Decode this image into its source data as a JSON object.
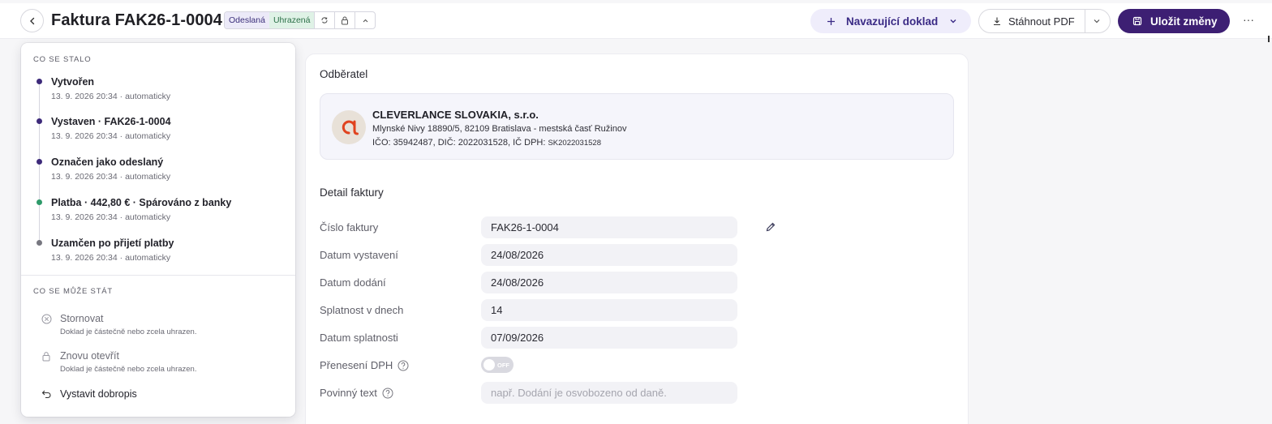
{
  "header": {
    "title": "Faktura FAK26-1-0004",
    "badges": {
      "sent": "Odeslaná",
      "paid": "Uhrazená"
    },
    "follow_label": "Navazující doklad",
    "pdf_label": "Stáhnout PDF",
    "save_label": "Uložit změny",
    "more_label": "···"
  },
  "history": {
    "title": "CO SE STALO",
    "items": [
      {
        "title": "Vytvořen",
        "sub": "13. 9. 2026 20:34 · automaticky",
        "color": "#3d2a7a"
      },
      {
        "title": "Vystaven · FAK26-1-0004",
        "sub": "13. 9. 2026 20:34 · automaticky",
        "color": "#3d2a7a"
      },
      {
        "title": "Označen jako odeslaný",
        "sub": "13. 9. 2026 20:34 · automaticky",
        "color": "#3d2a7a"
      },
      {
        "title": "Platba · 442,80 € · Spárováno z banky",
        "sub": "13. 9. 2026 20:34 · automaticky",
        "color": "#2e9a6a"
      },
      {
        "title": "Uzamčen po přijetí platby",
        "sub": "13. 9. 2026 20:34 · automaticky",
        "color": "#777780"
      }
    ]
  },
  "actions": {
    "title": "CO SE MŮŽE STÁT",
    "items": [
      {
        "title": "Stornovat",
        "sub": "Doklad je částečně nebo zcela uhrazen.",
        "icon": "cancel-circle-icon"
      },
      {
        "title": "Znovu otevřít",
        "sub": "Doklad je částečně nebo zcela uhrazen.",
        "icon": "lock-icon"
      },
      {
        "title": "Vystavit dobropis",
        "sub": "",
        "icon": "undo-icon"
      }
    ]
  },
  "customer": {
    "section_label": "Odběratel",
    "name": "CLEVERLANCE SLOVAKIA, s.r.o.",
    "address": "Mlynské Nivy 18890/5, 82109 Bratislava - mestská časť Ružinov",
    "ids": "IČO: 35942487, DIČ: 2022031528, IČ DPH:",
    "vat_id": "SK2022031528",
    "logo_color": "#e0431f"
  },
  "detail": {
    "section_label": "Detail faktury",
    "invoice_number_label": "Číslo faktury",
    "invoice_number": "FAK26-1-0004",
    "issue_date_label": "Datum vystavení",
    "issue_date": "24/08/2026",
    "delivery_date_label": "Datum dodání",
    "delivery_date": "24/08/2026",
    "due_days_label": "Splatnost v dnech",
    "due_days": "14",
    "due_date_label": "Datum splatnosti",
    "due_date": "07/09/2026",
    "reverse_charge_label": "Přenesení DPH",
    "reverse_charge_state": "OFF",
    "mandatory_text_label": "Povinný text",
    "mandatory_text_placeholder": "např. Dodání je osvobozeno od daně."
  },
  "colors": {
    "accent": "#3d1f73",
    "follow_bg": "#efedfb",
    "paid_badge_bg": "#dff2e6",
    "sent_badge_bg": "#eceaf8"
  }
}
